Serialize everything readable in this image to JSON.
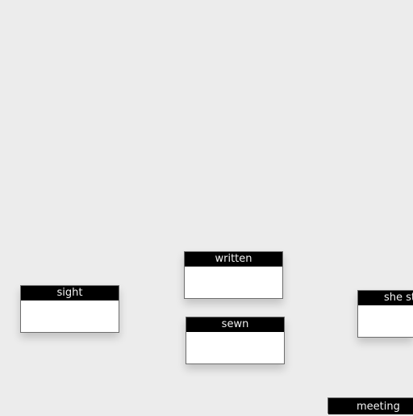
{
  "nodes": [
    {
      "label": "written"
    },
    {
      "label": "sight"
    },
    {
      "label": "sewn"
    },
    {
      "label": "she st"
    },
    {
      "label": "meeting"
    }
  ]
}
